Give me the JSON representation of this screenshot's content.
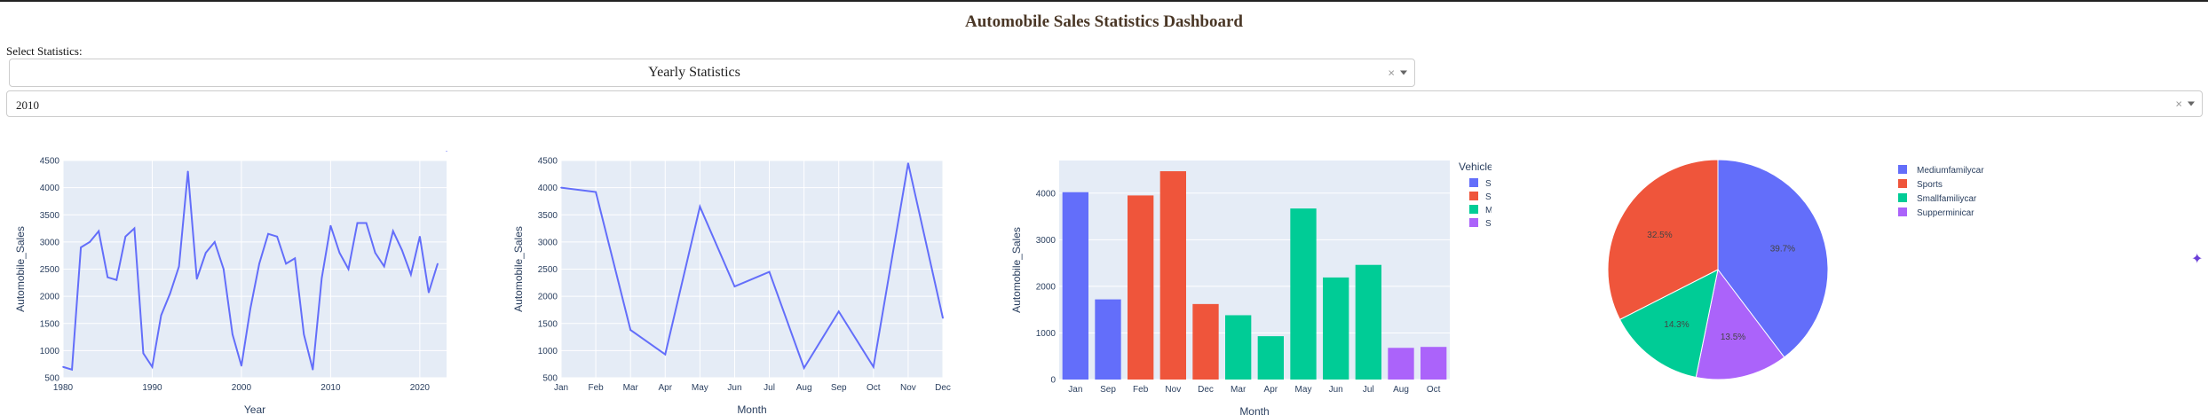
{
  "header": {
    "title": "Automobile Sales Statistics Dashboard"
  },
  "controls": {
    "select_label": "Select Statistics:",
    "statistics_dropdown": {
      "value": "Yearly Statistics"
    },
    "year_dropdown": {
      "value": "2010"
    }
  },
  "colors": {
    "primary": "#636efa",
    "sports": "#ef553b",
    "green": "#00cc96",
    "purple": "#ab63fa",
    "plot_bg": "#e5ecf6"
  },
  "chart_data": [
    {
      "type": "line",
      "xlabel": "Year",
      "ylabel": "Automobile_Sales",
      "xlim": [
        1980,
        2023
      ],
      "ylim": [
        500,
        4500
      ],
      "x_ticks": [
        1980,
        1990,
        2000,
        2010,
        2020
      ],
      "y_ticks": [
        500,
        1000,
        1500,
        2000,
        2500,
        3000,
        3500,
        4000,
        4500
      ],
      "x": [
        1980,
        1981,
        1982,
        1983,
        1984,
        1985,
        1986,
        1987,
        1988,
        1989,
        1990,
        1991,
        1992,
        1993,
        1994,
        1995,
        1996,
        1997,
        1998,
        1999,
        2000,
        2001,
        2002,
        2003,
        2004,
        2005,
        2006,
        2007,
        2008,
        2009,
        2010,
        2011,
        2012,
        2013,
        2014,
        2015,
        2016,
        2017,
        2018,
        2019,
        2020,
        2021,
        2022,
        2023
      ],
      "values": [
        700,
        650,
        2900,
        3000,
        3200,
        2350,
        2300,
        3100,
        3250,
        950,
        700,
        1650,
        2050,
        2550,
        4300,
        2320,
        2800,
        3000,
        2500,
        1300,
        720,
        1770,
        2600,
        3150,
        3100,
        2600,
        2700,
        1300,
        650,
        2330,
        3300,
        2800,
        2500,
        3350,
        3350,
        2800,
        2550,
        3200,
        2850,
        2400,
        3100,
        2070,
        2600
      ]
    },
    {
      "type": "line",
      "xlabel": "Month",
      "ylabel": "Automobile_Sales",
      "ylim": [
        500,
        4500
      ],
      "y_ticks": [
        500,
        1000,
        1500,
        2000,
        2500,
        3000,
        3500,
        4000,
        4500
      ],
      "categories": [
        "Jan",
        "Feb",
        "Mar",
        "Apr",
        "May",
        "Jun",
        "Jul",
        "Aug",
        "Sep",
        "Oct",
        "Nov",
        "Dec"
      ],
      "values": [
        4000,
        3920,
        1380,
        930,
        3650,
        2180,
        2450,
        680,
        1720,
        700,
        4450,
        1600
      ]
    },
    {
      "type": "bar",
      "xlabel": "Month",
      "ylabel": "Automobile_Sales",
      "ylim": [
        0,
        4700
      ],
      "y_ticks": [
        0,
        1000,
        2000,
        3000,
        4000
      ],
      "legend_title": "Vehicle_Type",
      "legend": [
        {
          "name": "Smallfamiliycar",
          "color": "#636efa"
        },
        {
          "name": "Sports",
          "color": "#ef553b"
        },
        {
          "name": "Mediumfamilycar",
          "color": "#00cc96"
        },
        {
          "name": "Supperminicar",
          "color": "#ab63fa"
        }
      ],
      "bars": [
        {
          "category": "Jan",
          "value": 4020,
          "color": "#636efa"
        },
        {
          "category": "Sep",
          "value": 1720,
          "color": "#636efa"
        },
        {
          "category": "Feb",
          "value": 3950,
          "color": "#ef553b"
        },
        {
          "category": "Nov",
          "value": 4470,
          "color": "#ef553b"
        },
        {
          "category": "Dec",
          "value": 1620,
          "color": "#ef553b"
        },
        {
          "category": "Mar",
          "value": 1380,
          "color": "#00cc96"
        },
        {
          "category": "Apr",
          "value": 930,
          "color": "#00cc96"
        },
        {
          "category": "May",
          "value": 3670,
          "color": "#00cc96"
        },
        {
          "category": "Jun",
          "value": 2190,
          "color": "#00cc96"
        },
        {
          "category": "Jul",
          "value": 2460,
          "color": "#00cc96"
        },
        {
          "category": "Aug",
          "value": 680,
          "color": "#ab63fa"
        },
        {
          "category": "Oct",
          "value": 700,
          "color": "#ab63fa"
        }
      ]
    },
    {
      "type": "pie",
      "slices": [
        {
          "name": "Mediumfamilycar",
          "value": 39.7,
          "label": "39.7%",
          "color": "#636efa"
        },
        {
          "name": "Supperminicar",
          "value": 13.5,
          "label": "13.5%",
          "color": "#ab63fa"
        },
        {
          "name": "Smallfamiliycar",
          "value": 14.3,
          "label": "14.3%",
          "color": "#00cc96"
        },
        {
          "name": "Sports",
          "value": 32.5,
          "label": "32.5%",
          "color": "#ef553b"
        }
      ],
      "legend": [
        {
          "name": "Mediumfamilycar",
          "color": "#636efa"
        },
        {
          "name": "Sports",
          "color": "#ef553b"
        },
        {
          "name": "Smallfamiliycar",
          "color": "#00cc96"
        },
        {
          "name": "Supperminicar",
          "color": "#ab63fa"
        }
      ]
    }
  ]
}
